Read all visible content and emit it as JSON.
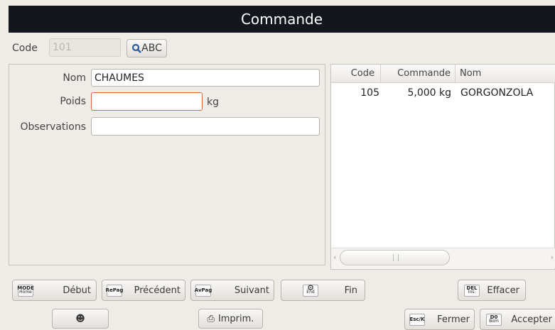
{
  "title": "Commande",
  "code": {
    "label": "Code",
    "value": "101",
    "search_button": "ABC"
  },
  "form": {
    "nom_label": "Nom",
    "nom_value": "CHAUMES",
    "poids_label": "Poids",
    "poids_value": "",
    "poids_unit": "kg",
    "obs_label": "Observations",
    "obs_value": ""
  },
  "table": {
    "columns": [
      "Code",
      "Commande",
      "Nom"
    ],
    "rows": [
      {
        "code": "105",
        "commande": "5,000 kg",
        "nom": "GORGONZOLA"
      }
    ]
  },
  "nav": {
    "debut": {
      "key_top": "MODE",
      "key_bottom": "Home",
      "label": "Début"
    },
    "precedent": {
      "key_top": "RePag",
      "label": "Précédent"
    },
    "suivant": {
      "key_top": "AvPag",
      "label": "Suivant"
    },
    "fin": {
      "key_bottom": "End",
      "label": "Fin"
    },
    "effacer": {
      "key_top": "DEL",
      "key_bottom": "Ins.",
      "label": "Effacer"
    }
  },
  "bottom": {
    "imprim_label": "Imprim.",
    "fermer": {
      "key_top": "Esc/K",
      "label": "Fermer"
    },
    "accepter": {
      "key_top": "D0",
      "key_bottom": "Bom",
      "label": "Accepter"
    }
  },
  "colors": {
    "title_bg": "#13161d",
    "focus_border": "#e0643c",
    "bg": "#efebe7"
  }
}
